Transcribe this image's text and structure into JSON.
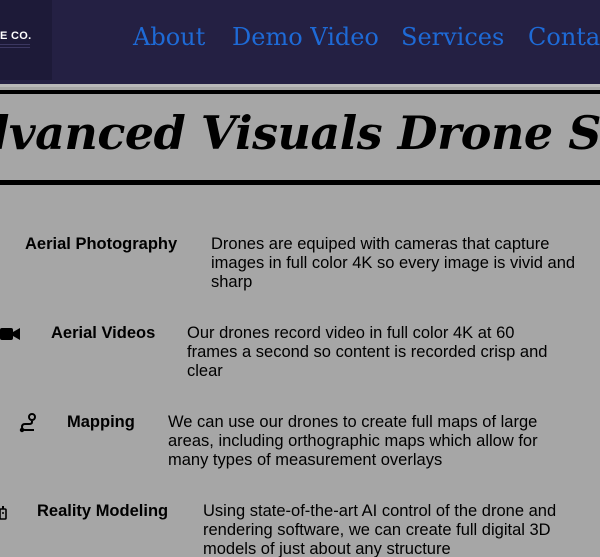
{
  "header": {
    "logo_text": "E CO.",
    "nav": {
      "about": "About",
      "demo_video": "Demo Video",
      "services": "Services",
      "contact": "Contac"
    }
  },
  "hero": {
    "title": "Advanced Visuals Drone Services"
  },
  "services": [
    {
      "name": "Aerial Photography",
      "icon": "camera-icon",
      "description": "Drones are equiped with cameras that capture images in full color 4K so every image is vivid and sharp"
    },
    {
      "name": "Aerial Videos",
      "icon": "video-camera-icon",
      "description": "Our drones record video in full color 4K at 60 frames a second so content is recorded crisp and clear"
    },
    {
      "name": "Mapping",
      "icon": "route-icon",
      "description": "We can use our drones to create full maps of large areas, including orthographic maps which allow for many types of measurement overlays"
    },
    {
      "name": "Reality Modeling",
      "icon": "robot-icon",
      "description": "Using state-of-the-art AI control of the drone and rendering software, we can create full digital 3D models of just about any structure"
    }
  ],
  "colors": {
    "header_bg": "#242043",
    "nav_link": "#1e6ad6",
    "page_bg": "#a6a6a6",
    "text": "#000000"
  }
}
